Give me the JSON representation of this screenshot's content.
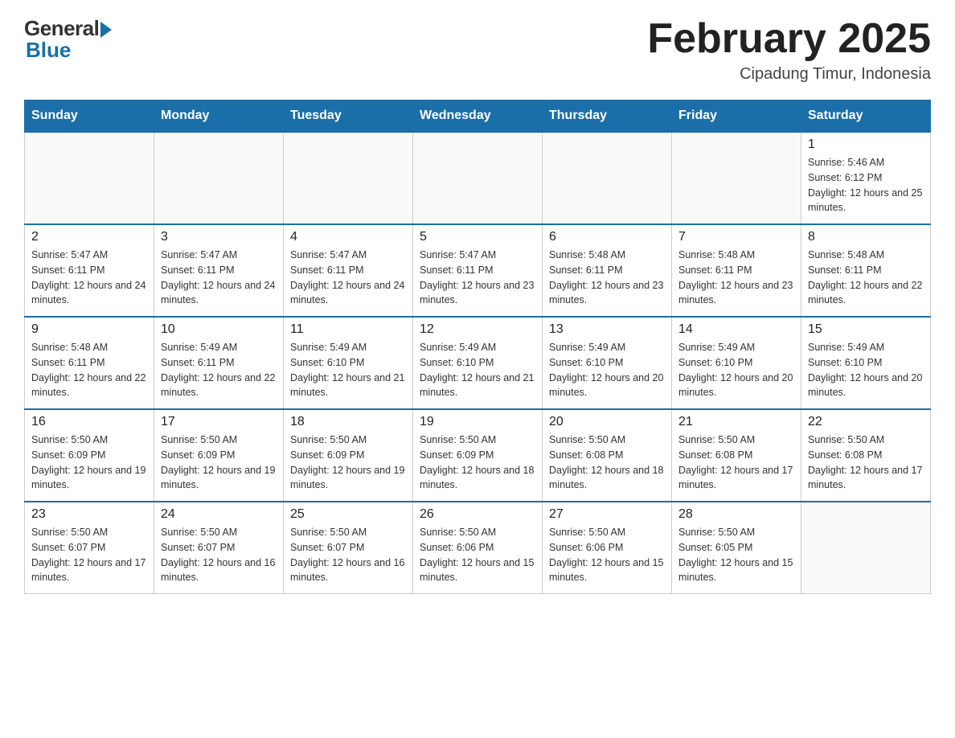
{
  "header": {
    "logo_general": "General",
    "logo_blue": "Blue",
    "month_title": "February 2025",
    "location": "Cipadung Timur, Indonesia"
  },
  "days_of_week": [
    "Sunday",
    "Monday",
    "Tuesday",
    "Wednesday",
    "Thursday",
    "Friday",
    "Saturday"
  ],
  "weeks": [
    [
      {
        "day": "",
        "sunrise": "",
        "sunset": "",
        "daylight": ""
      },
      {
        "day": "",
        "sunrise": "",
        "sunset": "",
        "daylight": ""
      },
      {
        "day": "",
        "sunrise": "",
        "sunset": "",
        "daylight": ""
      },
      {
        "day": "",
        "sunrise": "",
        "sunset": "",
        "daylight": ""
      },
      {
        "day": "",
        "sunrise": "",
        "sunset": "",
        "daylight": ""
      },
      {
        "day": "",
        "sunrise": "",
        "sunset": "",
        "daylight": ""
      },
      {
        "day": "1",
        "sunrise": "Sunrise: 5:46 AM",
        "sunset": "Sunset: 6:12 PM",
        "daylight": "Daylight: 12 hours and 25 minutes."
      }
    ],
    [
      {
        "day": "2",
        "sunrise": "Sunrise: 5:47 AM",
        "sunset": "Sunset: 6:11 PM",
        "daylight": "Daylight: 12 hours and 24 minutes."
      },
      {
        "day": "3",
        "sunrise": "Sunrise: 5:47 AM",
        "sunset": "Sunset: 6:11 PM",
        "daylight": "Daylight: 12 hours and 24 minutes."
      },
      {
        "day": "4",
        "sunrise": "Sunrise: 5:47 AM",
        "sunset": "Sunset: 6:11 PM",
        "daylight": "Daylight: 12 hours and 24 minutes."
      },
      {
        "day": "5",
        "sunrise": "Sunrise: 5:47 AM",
        "sunset": "Sunset: 6:11 PM",
        "daylight": "Daylight: 12 hours and 23 minutes."
      },
      {
        "day": "6",
        "sunrise": "Sunrise: 5:48 AM",
        "sunset": "Sunset: 6:11 PM",
        "daylight": "Daylight: 12 hours and 23 minutes."
      },
      {
        "day": "7",
        "sunrise": "Sunrise: 5:48 AM",
        "sunset": "Sunset: 6:11 PM",
        "daylight": "Daylight: 12 hours and 23 minutes."
      },
      {
        "day": "8",
        "sunrise": "Sunrise: 5:48 AM",
        "sunset": "Sunset: 6:11 PM",
        "daylight": "Daylight: 12 hours and 22 minutes."
      }
    ],
    [
      {
        "day": "9",
        "sunrise": "Sunrise: 5:48 AM",
        "sunset": "Sunset: 6:11 PM",
        "daylight": "Daylight: 12 hours and 22 minutes."
      },
      {
        "day": "10",
        "sunrise": "Sunrise: 5:49 AM",
        "sunset": "Sunset: 6:11 PM",
        "daylight": "Daylight: 12 hours and 22 minutes."
      },
      {
        "day": "11",
        "sunrise": "Sunrise: 5:49 AM",
        "sunset": "Sunset: 6:10 PM",
        "daylight": "Daylight: 12 hours and 21 minutes."
      },
      {
        "day": "12",
        "sunrise": "Sunrise: 5:49 AM",
        "sunset": "Sunset: 6:10 PM",
        "daylight": "Daylight: 12 hours and 21 minutes."
      },
      {
        "day": "13",
        "sunrise": "Sunrise: 5:49 AM",
        "sunset": "Sunset: 6:10 PM",
        "daylight": "Daylight: 12 hours and 20 minutes."
      },
      {
        "day": "14",
        "sunrise": "Sunrise: 5:49 AM",
        "sunset": "Sunset: 6:10 PM",
        "daylight": "Daylight: 12 hours and 20 minutes."
      },
      {
        "day": "15",
        "sunrise": "Sunrise: 5:49 AM",
        "sunset": "Sunset: 6:10 PM",
        "daylight": "Daylight: 12 hours and 20 minutes."
      }
    ],
    [
      {
        "day": "16",
        "sunrise": "Sunrise: 5:50 AM",
        "sunset": "Sunset: 6:09 PM",
        "daylight": "Daylight: 12 hours and 19 minutes."
      },
      {
        "day": "17",
        "sunrise": "Sunrise: 5:50 AM",
        "sunset": "Sunset: 6:09 PM",
        "daylight": "Daylight: 12 hours and 19 minutes."
      },
      {
        "day": "18",
        "sunrise": "Sunrise: 5:50 AM",
        "sunset": "Sunset: 6:09 PM",
        "daylight": "Daylight: 12 hours and 19 minutes."
      },
      {
        "day": "19",
        "sunrise": "Sunrise: 5:50 AM",
        "sunset": "Sunset: 6:09 PM",
        "daylight": "Daylight: 12 hours and 18 minutes."
      },
      {
        "day": "20",
        "sunrise": "Sunrise: 5:50 AM",
        "sunset": "Sunset: 6:08 PM",
        "daylight": "Daylight: 12 hours and 18 minutes."
      },
      {
        "day": "21",
        "sunrise": "Sunrise: 5:50 AM",
        "sunset": "Sunset: 6:08 PM",
        "daylight": "Daylight: 12 hours and 17 minutes."
      },
      {
        "day": "22",
        "sunrise": "Sunrise: 5:50 AM",
        "sunset": "Sunset: 6:08 PM",
        "daylight": "Daylight: 12 hours and 17 minutes."
      }
    ],
    [
      {
        "day": "23",
        "sunrise": "Sunrise: 5:50 AM",
        "sunset": "Sunset: 6:07 PM",
        "daylight": "Daylight: 12 hours and 17 minutes."
      },
      {
        "day": "24",
        "sunrise": "Sunrise: 5:50 AM",
        "sunset": "Sunset: 6:07 PM",
        "daylight": "Daylight: 12 hours and 16 minutes."
      },
      {
        "day": "25",
        "sunrise": "Sunrise: 5:50 AM",
        "sunset": "Sunset: 6:07 PM",
        "daylight": "Daylight: 12 hours and 16 minutes."
      },
      {
        "day": "26",
        "sunrise": "Sunrise: 5:50 AM",
        "sunset": "Sunset: 6:06 PM",
        "daylight": "Daylight: 12 hours and 15 minutes."
      },
      {
        "day": "27",
        "sunrise": "Sunrise: 5:50 AM",
        "sunset": "Sunset: 6:06 PM",
        "daylight": "Daylight: 12 hours and 15 minutes."
      },
      {
        "day": "28",
        "sunrise": "Sunrise: 5:50 AM",
        "sunset": "Sunset: 6:05 PM",
        "daylight": "Daylight: 12 hours and 15 minutes."
      },
      {
        "day": "",
        "sunrise": "",
        "sunset": "",
        "daylight": ""
      }
    ]
  ]
}
